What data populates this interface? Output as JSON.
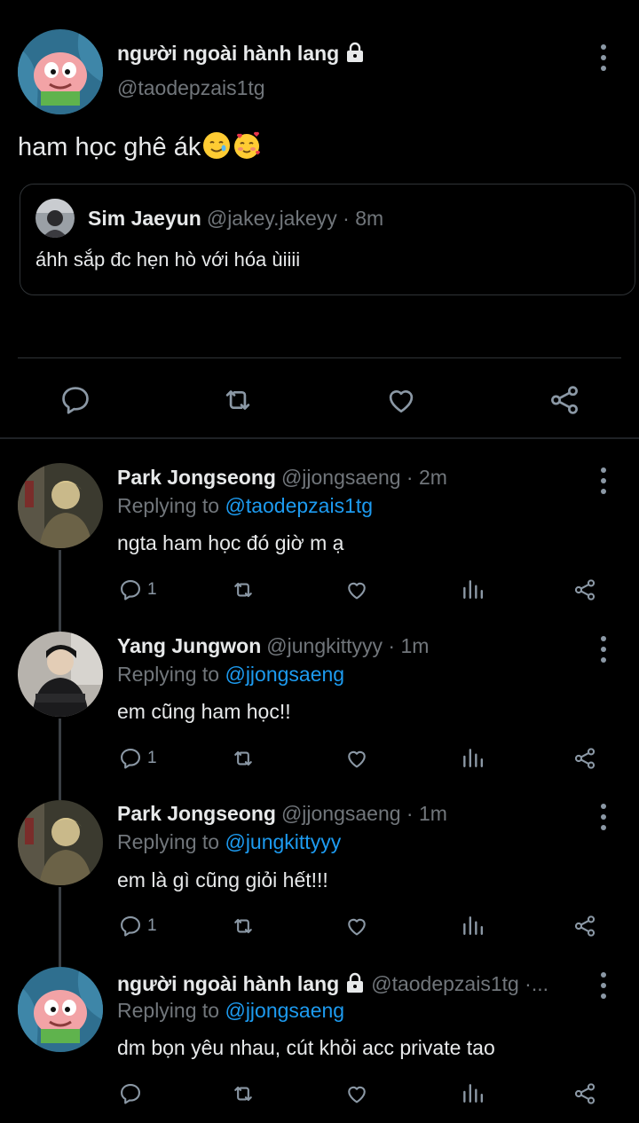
{
  "main_tweet": {
    "display_name": "người ngoài hành lang",
    "handle": "@taodepzais1tg",
    "text": "ham học ghê ák",
    "quote": {
      "display_name": "Sim Jaeyun",
      "meta": "@jakey.jakeyy · 8m",
      "text": "áhh sắp đc hẹn hò với hóa ùiiii"
    }
  },
  "replies": [
    {
      "display_name": "Park Jongseong",
      "meta": "@jjongsaeng · 2m",
      "replying_prefix": "Replying to ",
      "replying_to": "@taodepzais1tg",
      "text": "ngta ham học đó giờ m ạ",
      "reply_count": "1"
    },
    {
      "display_name": "Yang Jungwon",
      "meta": "@jungkittyyy · 1m",
      "replying_prefix": "Replying to ",
      "replying_to": "@jjongsaeng",
      "text": "em cũng ham học!!",
      "reply_count": "1"
    },
    {
      "display_name": "Park Jongseong",
      "meta": "@jjongsaeng · 1m",
      "replying_prefix": "Replying to ",
      "replying_to": "@jungkittyyy",
      "text": "em là gì cũng giỏi hết!!!",
      "reply_count": "1"
    },
    {
      "display_name": "người ngoài hành lang",
      "meta": "@taodepzais1tg ·...",
      "replying_prefix": "Replying to ",
      "replying_to": "@jjongsaeng",
      "text": "dm bọn yêu nhau, cút khỏi acc private tao",
      "reply_count": ""
    }
  ],
  "colors": {
    "background": "#000000",
    "text_primary": "#e7e9ea",
    "text_secondary": "#71767b",
    "mention": "#1d9bf0",
    "divider": "#2f3336"
  },
  "icons": [
    "reply-icon",
    "retweet-icon",
    "like-icon",
    "share-icon",
    "analytics-icon",
    "more-options-icon",
    "lock-icon"
  ]
}
